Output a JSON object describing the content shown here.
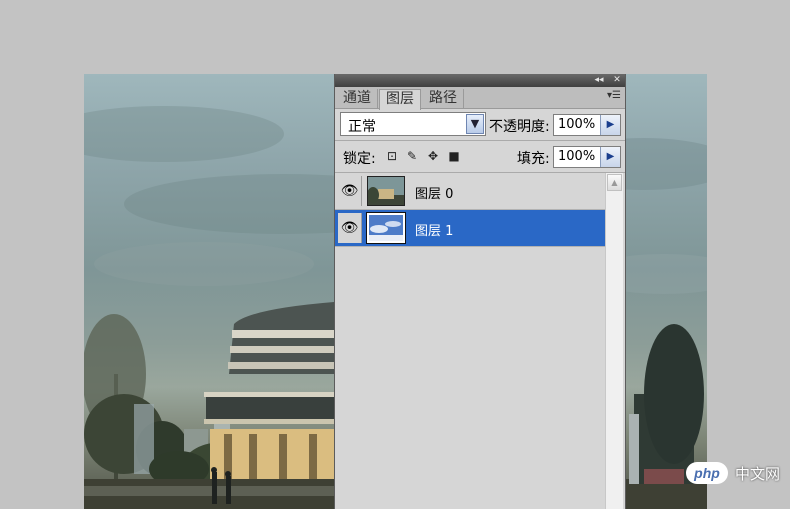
{
  "panel": {
    "tabs": [
      "通道",
      "图层",
      "路径"
    ],
    "active_tab": "图层",
    "blend_mode": "正常",
    "opacity_label": "不透明度:",
    "opacity_value": "100%",
    "lock_label": "锁定:",
    "fill_label": "填充:",
    "fill_value": "100%",
    "layers": [
      {
        "name": "图层 0",
        "visible": true,
        "selected": false
      },
      {
        "name": "图层 1",
        "visible": true,
        "selected": true
      }
    ]
  },
  "watermark": {
    "logo": "php",
    "text": "中文网"
  },
  "colors": {
    "selection": "#2a68c6",
    "panel_bg": "#d6d6d6",
    "workspace_bg": "#c3c3c3"
  }
}
